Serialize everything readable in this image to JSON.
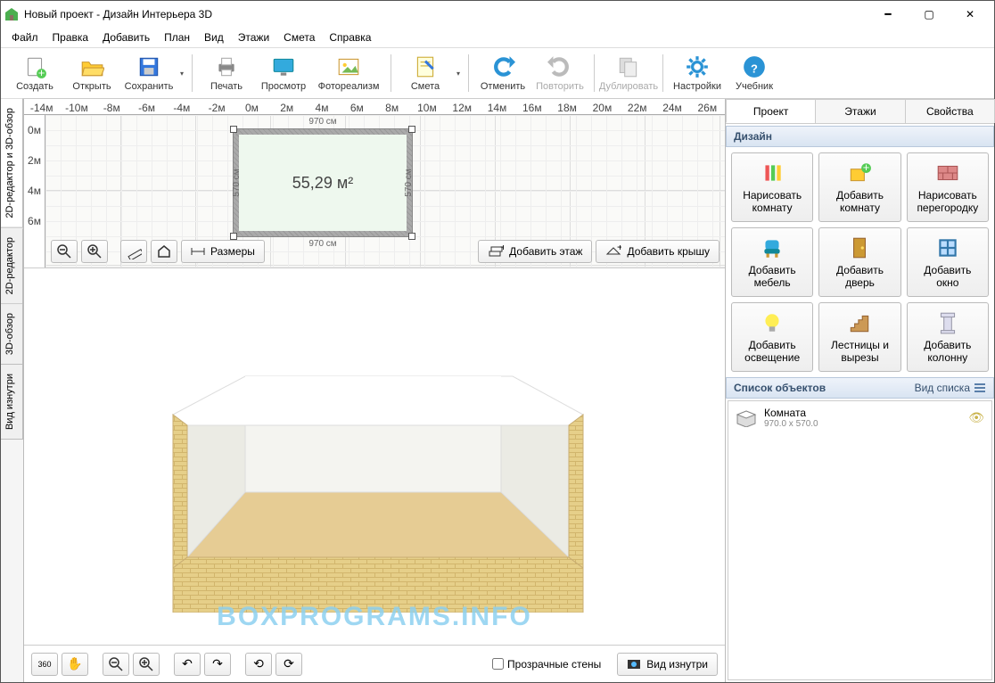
{
  "title": "Новый проект - Дизайн Интерьера 3D",
  "menu": [
    "Файл",
    "Правка",
    "Добавить",
    "План",
    "Вид",
    "Этажи",
    "Смета",
    "Справка"
  ],
  "toolbar": [
    {
      "label": "Создать",
      "icon": "file-new",
      "split": false
    },
    {
      "label": "Открыть",
      "icon": "folder-open",
      "split": false
    },
    {
      "label": "Сохранить",
      "icon": "save",
      "split": true,
      "sep_after": true
    },
    {
      "label": "Печать",
      "icon": "printer",
      "split": false
    },
    {
      "label": "Просмотр",
      "icon": "monitor",
      "split": false
    },
    {
      "label": "Фотореализм",
      "icon": "photo",
      "split": false,
      "sep_after": true,
      "wide": true
    },
    {
      "label": "Смета",
      "icon": "notepad",
      "split": true,
      "sep_after": true
    },
    {
      "label": "Отменить",
      "icon": "undo",
      "split": false
    },
    {
      "label": "Повторить",
      "icon": "redo",
      "split": false,
      "disabled": true,
      "sep_after": true
    },
    {
      "label": "Дублировать",
      "icon": "copy",
      "split": false,
      "disabled": true,
      "sep_after": true
    },
    {
      "label": "Настройки",
      "icon": "gear",
      "split": false
    },
    {
      "label": "Учебник",
      "icon": "help",
      "split": false
    }
  ],
  "vtabs": [
    "2D-редактор и 3D-обзор",
    "2D-редактор",
    "3D-обзор",
    "Вид изнутри"
  ],
  "ruler_h": [
    "-14м",
    "-10м",
    "-8м",
    "-6м",
    "-4м",
    "-2м",
    "0м",
    "2м",
    "4м",
    "6м",
    "8м",
    "10м",
    "12м",
    "14м",
    "16м",
    "18м",
    "20м",
    "22м",
    "24м",
    "26м"
  ],
  "ruler_v": [
    "0м",
    "2м",
    "4м",
    "6м"
  ],
  "room": {
    "w": "970 см",
    "h": "570 см",
    "area": "55,29 м²"
  },
  "view_toolbar": {
    "dimensions": "Размеры",
    "add_floor": "Добавить этаж",
    "add_roof": "Добавить крышу"
  },
  "rtabs": [
    "Проект",
    "Этажи",
    "Свойства"
  ],
  "section_design": "Дизайн",
  "design_buttons": [
    {
      "l1": "Нарисовать",
      "l2": "комнату",
      "icon": "pencils"
    },
    {
      "l1": "Добавить",
      "l2": "комнату",
      "icon": "add-shape"
    },
    {
      "l1": "Нарисовать",
      "l2": "перегородку",
      "icon": "bricks"
    },
    {
      "l1": "Добавить",
      "l2": "мебель",
      "icon": "chair"
    },
    {
      "l1": "Добавить",
      "l2": "дверь",
      "icon": "door"
    },
    {
      "l1": "Добавить",
      "l2": "окно",
      "icon": "window"
    },
    {
      "l1": "Добавить",
      "l2": "освещение",
      "icon": "bulb"
    },
    {
      "l1": "Лестницы и",
      "l2": "вырезы",
      "icon": "stairs"
    },
    {
      "l1": "Добавить",
      "l2": "колонну",
      "icon": "column"
    }
  ],
  "obj_list_title": "Список объектов",
  "view_mode_label": "Вид списка",
  "objects": [
    {
      "name": "Комната",
      "dims": "970.0 x 570.0"
    }
  ],
  "bottom": {
    "transparent": "Прозрачные стены",
    "inside": "Вид изнутри"
  },
  "watermark": "BOXPROGRAMS.INFO"
}
